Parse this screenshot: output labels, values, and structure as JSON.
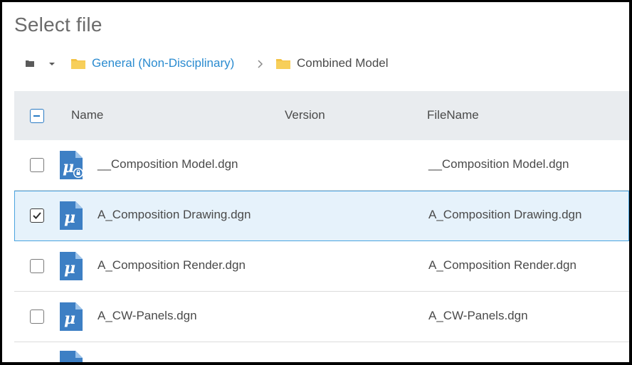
{
  "dialog": {
    "title": "Select file"
  },
  "breadcrumb": {
    "items": [
      {
        "label": "General (Non-Disciplinary)",
        "link": true
      },
      {
        "label": "Combined Model",
        "link": false
      }
    ]
  },
  "table": {
    "columns": {
      "name": "Name",
      "version": "Version",
      "filename": "FileName"
    },
    "rows": [
      {
        "name": "__Composition Model.dgn",
        "version": "",
        "filename": "__Composition Model.dgn",
        "checked": false,
        "locked": true
      },
      {
        "name": "A_Composition Drawing.dgn",
        "version": "",
        "filename": "A_Composition Drawing.dgn",
        "checked": true,
        "locked": false
      },
      {
        "name": "A_Composition Render.dgn",
        "version": "",
        "filename": "A_Composition Render.dgn",
        "checked": false,
        "locked": false
      },
      {
        "name": "A_CW-Panels.dgn",
        "version": "",
        "filename": "A_CW-Panels.dgn",
        "checked": false,
        "locked": false
      }
    ]
  },
  "colors": {
    "accent": "#2a8bd0",
    "selected_bg": "#e6f2fb",
    "header_bg": "#e9ecef",
    "icon_blue": "#3d7fc4"
  }
}
